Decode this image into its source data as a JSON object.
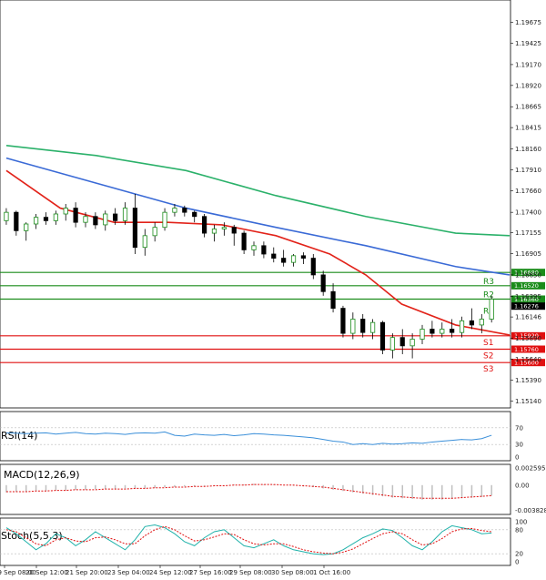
{
  "chart_data": [
    {
      "type": "candlestick",
      "pane": "price",
      "y_ticks": [
        "1.19675",
        "1.19425",
        "1.19170",
        "1.18920",
        "1.18665",
        "1.18415",
        "1.18160",
        "1.17910",
        "1.17660",
        "1.17400",
        "1.17155",
        "1.16905",
        "1.16650",
        "1.16395",
        "1.16146",
        "1.15890",
        "1.15640",
        "1.15390",
        "1.15140"
      ],
      "ylim": [
        1.151,
        1.199
      ],
      "x_ticks": [
        "19 Sep 08:00",
        "20 Sep 12:00",
        "21 Sep 20:00",
        "23 Sep 04:00",
        "24 Sep 12:00",
        "27 Sep 16:00",
        "29 Sep 08:00",
        "30 Sep 08:00",
        "1 Oct 16:00"
      ],
      "current_price": "1.16276",
      "current_price_value": 1.16276,
      "levels": [
        {
          "name": "",
          "value": 1.1668,
          "label": "1.16680",
          "color": "#1a8c1a"
        },
        {
          "name": "R3",
          "value": 1.1652,
          "label": "1.16520",
          "color": "#1a8c1a"
        },
        {
          "name": "R2",
          "value": 1.1636,
          "label": "1.16360",
          "color": "#1a8c1a"
        },
        {
          "name": "R1",
          "value": 1.1636,
          "label": "",
          "color": "#1a8c1a"
        },
        {
          "name": "S1",
          "value": 1.1592,
          "label": "1.15920",
          "color": "#e01010"
        },
        {
          "name": "S2",
          "value": 1.1576,
          "label": "1.15760",
          "color": "#e01010"
        },
        {
          "name": "S3",
          "value": 1.156,
          "label": "1.15600",
          "color": "#e01010"
        }
      ],
      "moving_averages": [
        {
          "color": "#2bb16a",
          "x": [
            0,
            10,
            20,
            30,
            40,
            50,
            56
          ],
          "values": [
            1.182,
            1.1808,
            1.179,
            1.176,
            1.1735,
            1.1715,
            1.1712
          ]
        },
        {
          "color": "#3a6ad6",
          "x": [
            0,
            10,
            20,
            30,
            40,
            50,
            56
          ],
          "values": [
            1.1805,
            1.1775,
            1.1745,
            1.1722,
            1.17,
            1.1675,
            1.1665
          ]
        },
        {
          "color": "#e2231a",
          "x": [
            0,
            6,
            12,
            18,
            24,
            30,
            36,
            40,
            44,
            50,
            56
          ],
          "values": [
            1.179,
            1.1745,
            1.1728,
            1.1728,
            1.1725,
            1.1712,
            1.169,
            1.1665,
            1.163,
            1.1605,
            1.1593
          ]
        }
      ],
      "candles": [
        [
          0,
          1.173,
          1.1745,
          1.1725,
          1.174
        ],
        [
          1,
          1.174,
          1.1742,
          1.1712,
          1.1718
        ],
        [
          2,
          1.1718,
          1.1728,
          1.1706,
          1.1726
        ],
        [
          3,
          1.1726,
          1.1738,
          1.172,
          1.1734
        ],
        [
          4,
          1.1734,
          1.174,
          1.1725,
          1.173
        ],
        [
          5,
          1.173,
          1.1742,
          1.1725,
          1.1738
        ],
        [
          6,
          1.1738,
          1.175,
          1.173,
          1.1745
        ],
        [
          7,
          1.1745,
          1.1752,
          1.1722,
          1.1728
        ],
        [
          8,
          1.1728,
          1.174,
          1.1722,
          1.1735
        ],
        [
          9,
          1.1735,
          1.174,
          1.172,
          1.1725
        ],
        [
          10,
          1.1725,
          1.1742,
          1.1718,
          1.1738
        ],
        [
          11,
          1.1738,
          1.1745,
          1.1725,
          1.173
        ],
        [
          12,
          1.173,
          1.1752,
          1.1725,
          1.1745
        ],
        [
          13,
          1.1745,
          1.1762,
          1.169,
          1.1698
        ],
        [
          14,
          1.1698,
          1.172,
          1.1688,
          1.1712
        ],
        [
          15,
          1.1712,
          1.1728,
          1.1705,
          1.1722
        ],
        [
          16,
          1.1722,
          1.1745,
          1.1718,
          1.174
        ],
        [
          17,
          1.174,
          1.175,
          1.1735,
          1.1745
        ],
        [
          18,
          1.1745,
          1.1748,
          1.1735,
          1.174
        ],
        [
          19,
          1.174,
          1.1742,
          1.1728,
          1.1735
        ],
        [
          20,
          1.1735,
          1.1738,
          1.171,
          1.1715
        ],
        [
          21,
          1.1715,
          1.1725,
          1.1705,
          1.172
        ],
        [
          22,
          1.172,
          1.1728,
          1.1712,
          1.1722
        ],
        [
          23,
          1.1722,
          1.1725,
          1.17,
          1.1715
        ],
        [
          24,
          1.1715,
          1.1718,
          1.169,
          1.1695
        ],
        [
          25,
          1.1695,
          1.1705,
          1.1688,
          1.17
        ],
        [
          26,
          1.17,
          1.1705,
          1.1685,
          1.169
        ],
        [
          27,
          1.169,
          1.1698,
          1.168,
          1.1685
        ],
        [
          28,
          1.1685,
          1.1695,
          1.1675,
          1.168
        ],
        [
          29,
          1.168,
          1.169,
          1.1675,
          1.1688
        ],
        [
          30,
          1.1688,
          1.1692,
          1.1678,
          1.1685
        ],
        [
          31,
          1.1685,
          1.169,
          1.166,
          1.1665
        ],
        [
          32,
          1.1665,
          1.167,
          1.164,
          1.1645
        ],
        [
          33,
          1.1645,
          1.1655,
          1.162,
          1.1625
        ],
        [
          34,
          1.1625,
          1.1628,
          1.159,
          1.1595
        ],
        [
          35,
          1.1595,
          1.162,
          1.1588,
          1.1612
        ],
        [
          36,
          1.1612,
          1.1618,
          1.159,
          1.1596
        ],
        [
          37,
          1.1596,
          1.1612,
          1.1588,
          1.1608
        ],
        [
          38,
          1.1608,
          1.161,
          1.157,
          1.1575
        ],
        [
          39,
          1.1575,
          1.1595,
          1.1565,
          1.159
        ],
        [
          40,
          1.159,
          1.16,
          1.157,
          1.158
        ],
        [
          41,
          1.158,
          1.1595,
          1.1565,
          1.1588
        ],
        [
          42,
          1.1588,
          1.1605,
          1.1582,
          1.16
        ],
        [
          43,
          1.16,
          1.161,
          1.159,
          1.1595
        ],
        [
          44,
          1.1595,
          1.1608,
          1.159,
          1.16
        ],
        [
          45,
          1.16,
          1.1612,
          1.159,
          1.1596
        ],
        [
          46,
          1.1596,
          1.1615,
          1.159,
          1.161
        ],
        [
          47,
          1.161,
          1.1625,
          1.16,
          1.1605
        ],
        [
          48,
          1.1605,
          1.1618,
          1.1595,
          1.1612
        ],
        [
          49,
          1.1612,
          1.164,
          1.1608,
          1.1636
        ]
      ]
    },
    {
      "type": "line",
      "pane": "rsi",
      "title": "RSI(14)",
      "y_ticks": [
        "70",
        "30",
        "0"
      ],
      "ylim": [
        0,
        100
      ],
      "series": [
        {
          "color": "#3a8fd9",
          "values": [
            58,
            57,
            56,
            57,
            58,
            55,
            57,
            59,
            56,
            55,
            57,
            56,
            54,
            57,
            58,
            57,
            60,
            52,
            50,
            55,
            53,
            52,
            54,
            51,
            53,
            56,
            55,
            53,
            52,
            50,
            48,
            46,
            42,
            38,
            36,
            30,
            32,
            30,
            33,
            31,
            32,
            34,
            33,
            36,
            38,
            40,
            42,
            41,
            44,
            52
          ]
        }
      ]
    },
    {
      "type": "histogram",
      "pane": "macd",
      "title": "MACD(12,26,9)",
      "y_ticks": [
        "0.002595",
        "0.00",
        "-0.003828"
      ],
      "ylim": [
        -0.0039,
        0.0026
      ],
      "series": [
        {
          "name": "",
          "type": "bar",
          "color": "#c0c0c0",
          "values": [
            -0.0011,
            -0.001,
            -0.001,
            -0.0009,
            -0.0009,
            -0.0008,
            -0.0008,
            -0.0007,
            -0.0007,
            -0.0006,
            -0.0006,
            -0.0006,
            -0.0005,
            -0.0005,
            -0.0005,
            -0.0004,
            -0.0003,
            -0.0003,
            -0.0002,
            -0.0002,
            -0.0001,
            -0.0001,
            0.0,
            0.0001,
            0.0001,
            0.0002,
            0.0001,
            0.0001,
            0.0,
            -0.0001,
            -0.0002,
            -0.0003,
            -0.0005,
            -0.0007,
            -0.0009,
            -0.0011,
            -0.0013,
            -0.0015,
            -0.0017,
            -0.0019,
            -0.002,
            -0.0021,
            -0.0022,
            -0.0022,
            -0.0022,
            -0.0021,
            -0.002,
            -0.0019,
            -0.0018,
            -0.0016
          ]
        },
        {
          "name": "",
          "type": "line",
          "color": "#e01010",
          "values": [
            -0.001,
            -0.001,
            -0.001,
            -0.0009,
            -0.0009,
            -0.0008,
            -0.0008,
            -0.0007,
            -0.0007,
            -0.0007,
            -0.0006,
            -0.0006,
            -0.0006,
            -0.0005,
            -0.0005,
            -0.0004,
            -0.0004,
            -0.0003,
            -0.0003,
            -0.0002,
            -0.0002,
            -0.0001,
            -0.0001,
            0.0,
            0.0,
            0.0001,
            0.0001,
            0.0001,
            0.0,
            0.0,
            -0.0001,
            -0.0002,
            -0.0003,
            -0.0005,
            -0.0007,
            -0.0009,
            -0.0011,
            -0.0013,
            -0.0015,
            -0.0017,
            -0.0018,
            -0.0019,
            -0.002,
            -0.002,
            -0.002,
            -0.002,
            -0.0019,
            -0.0018,
            -0.0017,
            -0.0016
          ]
        }
      ]
    },
    {
      "type": "line",
      "pane": "stochastic",
      "title": "Stoch(5,5,3)",
      "y_ticks": [
        "100",
        "80",
        "20",
        "0"
      ],
      "ylim": [
        0,
        100
      ],
      "series": [
        {
          "name": "",
          "color": "#20b2aa",
          "values": [
            85,
            70,
            50,
            30,
            45,
            70,
            60,
            40,
            55,
            75,
            60,
            45,
            30,
            55,
            88,
            92,
            85,
            70,
            50,
            40,
            60,
            75,
            80,
            60,
            40,
            35,
            45,
            55,
            40,
            30,
            25,
            20,
            18,
            20,
            30,
            45,
            60,
            70,
            82,
            78,
            60,
            40,
            30,
            50,
            75,
            90,
            85,
            80,
            70,
            72
          ]
        },
        {
          "name": "",
          "color": "#e01010",
          "dash": true,
          "values": [
            80,
            75,
            60,
            45,
            40,
            55,
            60,
            52,
            50,
            60,
            62,
            55,
            45,
            45,
            65,
            80,
            88,
            80,
            65,
            52,
            55,
            62,
            70,
            68,
            55,
            45,
            42,
            45,
            45,
            38,
            30,
            25,
            22,
            20,
            24,
            32,
            45,
            58,
            70,
            75,
            70,
            55,
            42,
            45,
            58,
            75,
            82,
            83,
            78,
            75
          ]
        }
      ]
    }
  ]
}
